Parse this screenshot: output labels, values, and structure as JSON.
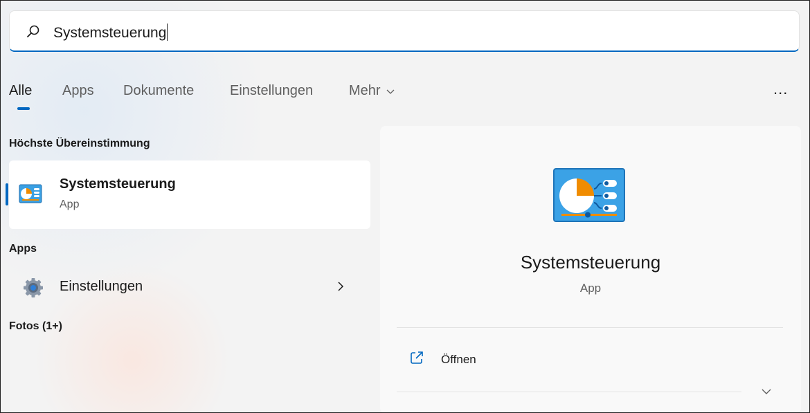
{
  "search": {
    "value": "Systemsteuerung",
    "icon": "search-icon"
  },
  "tabs": [
    {
      "label": "Alle",
      "active": true
    },
    {
      "label": "Apps"
    },
    {
      "label": "Dokumente"
    },
    {
      "label": "Einstellungen"
    },
    {
      "label": "Mehr"
    }
  ],
  "more_menu": "...",
  "best_match": {
    "heading": "Höchste Übereinstimmung",
    "title": "Systemsteuerung",
    "subtitle": "App",
    "icon": "control-panel-icon"
  },
  "apps": {
    "heading": "Apps",
    "items": [
      {
        "label": "Einstellungen",
        "icon": "gear-icon"
      }
    ]
  },
  "photos": {
    "heading": "Fotos (1+)"
  },
  "detail": {
    "title": "Systemsteuerung",
    "subtitle": "App",
    "actions": [
      {
        "label": "Öffnen",
        "icon": "open-external-icon"
      }
    ]
  },
  "colors": {
    "accent": "#0067c0",
    "panel_icon_blue": "#3fa0e0",
    "panel_icon_orange": "#f08c00"
  }
}
